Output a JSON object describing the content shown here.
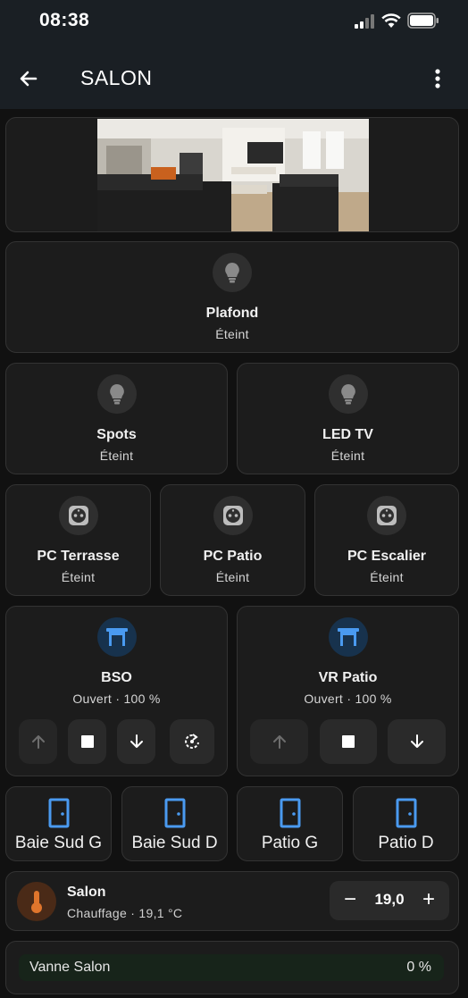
{
  "status_bar": {
    "time": "08:38"
  },
  "app_bar": {
    "title": "SALON",
    "back_icon": "arrow-back-icon",
    "menu_icon": "more-vertical-icon"
  },
  "camera": {
    "image_icon": "living-room-photo"
  },
  "lights": [
    {
      "name": "Plafond",
      "state": "Éteint",
      "icon": "lightbulb-icon"
    },
    {
      "name": "Spots",
      "state": "Éteint",
      "icon": "lightbulb-icon"
    },
    {
      "name": "LED TV",
      "state": "Éteint",
      "icon": "lightbulb-icon"
    }
  ],
  "outlets": [
    {
      "name": "PC Terrasse",
      "state": "Éteint",
      "icon": "power-socket-icon"
    },
    {
      "name": "PC Patio",
      "state": "Éteint",
      "icon": "power-socket-icon"
    },
    {
      "name": "PC Escalier",
      "state": "Éteint",
      "icon": "power-socket-icon"
    }
  ],
  "covers": [
    {
      "name": "BSO",
      "state": "Ouvert · 100 %",
      "position": 100,
      "buttons": [
        "arrow-up-icon",
        "stop-icon",
        "arrow-down-icon",
        "tilt-rotate-icon"
      ]
    },
    {
      "name": "VR Patio",
      "state": "Ouvert · 100 %",
      "position": 100,
      "buttons": [
        "arrow-up-icon",
        "stop-icon",
        "arrow-down-icon"
      ]
    }
  ],
  "doors": [
    {
      "name": "Baie Sud G",
      "icon": "door-icon"
    },
    {
      "name": "Baie Sud D",
      "icon": "door-icon"
    },
    {
      "name": "Patio G",
      "icon": "door-icon"
    },
    {
      "name": "Patio D",
      "icon": "door-icon"
    }
  ],
  "thermostat": {
    "name": "Salon",
    "subtitle": "Chauffage · 19,1 °C",
    "target": "19,0",
    "minus": "−",
    "plus": "+",
    "icon": "thermometer-icon",
    "accent": "#e0752c"
  },
  "valve": {
    "label": "Vanne Salon",
    "value": "0 %",
    "percent": 0
  },
  "colors": {
    "blue_accent": "#4a9af0",
    "bulb_off": "#8a8a8a"
  }
}
